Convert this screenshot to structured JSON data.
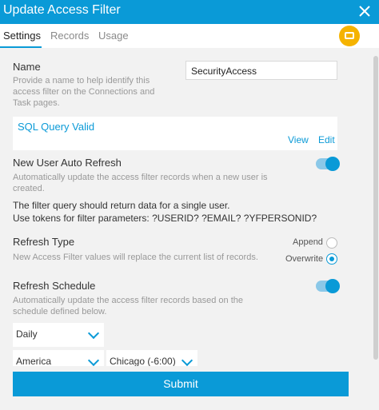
{
  "window": {
    "title": "Update Access Filter"
  },
  "tabs": [
    {
      "label": "Settings"
    },
    {
      "label": "Records"
    },
    {
      "label": "Usage"
    }
  ],
  "name_section": {
    "label": "Name",
    "help": "Provide a name to help identify this access filter on the Connections and Task pages.",
    "value": "SecurityAccess"
  },
  "sql": {
    "status": "SQL Query Valid",
    "view_label": "View",
    "edit_label": "Edit"
  },
  "auto_refresh": {
    "label": "New User Auto Refresh",
    "help": "Automatically update the access filter records when a new user is created.",
    "enabled": true
  },
  "query_note": {
    "line1": "The filter query should return data for a single user.",
    "line2": "Use tokens for filter parameters: ?USERID? ?EMAIL? ?YFPERSONID?"
  },
  "refresh_type": {
    "label": "Refresh Type",
    "help": "New Access Filter values will replace the current list of records.",
    "options": [
      {
        "label": "Append",
        "selected": false
      },
      {
        "label": "Overwrite",
        "selected": true
      }
    ]
  },
  "refresh_schedule": {
    "label": "Refresh Schedule",
    "help": "Automatically update the access filter records based on the schedule defined below.",
    "enabled": true,
    "frequency": "Daily",
    "region": "America",
    "timezone": "Chicago (-6:00)"
  },
  "footer": {
    "submit_label": "Submit"
  },
  "colors": {
    "accent": "#0a9ad7",
    "pin": "#f5b300",
    "panel": "#f2f2f2"
  }
}
